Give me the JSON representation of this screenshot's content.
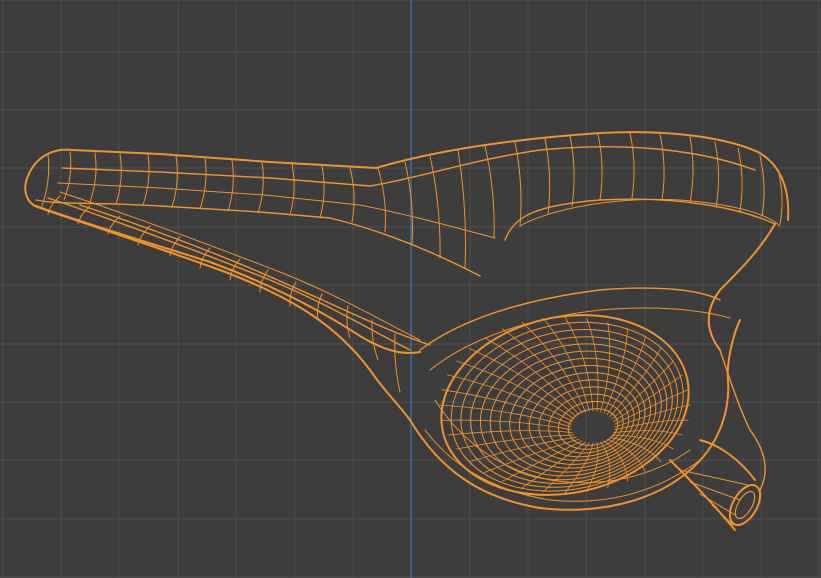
{
  "viewport": {
    "view": "3d-viewport",
    "shading": "wireframe",
    "selection": "selected-object",
    "object": "earphone-headset-mesh"
  },
  "colors": {
    "background": "#3d3d3d",
    "grid_line": "#4b4b4b",
    "y_axis": "#3d6a9e",
    "wire_selected": "#f0932b",
    "wire_selected_bright": "#ffa53a"
  }
}
